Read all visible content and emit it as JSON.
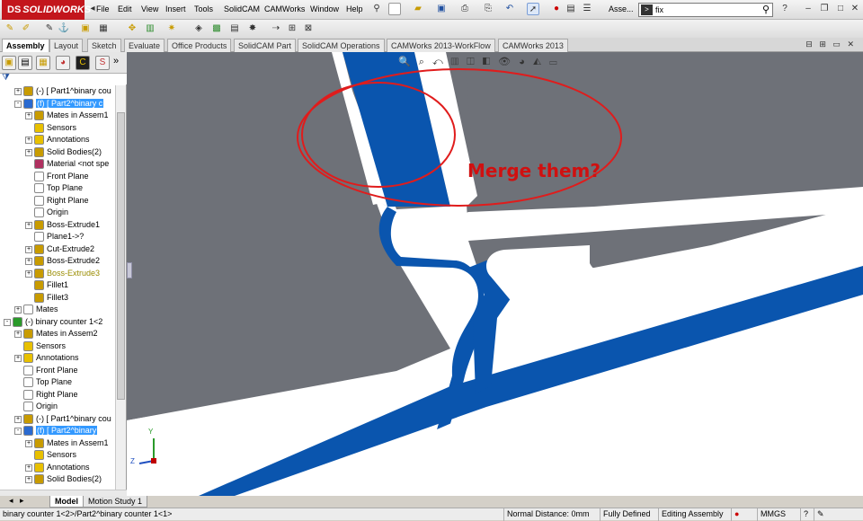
{
  "app": {
    "logo": "SOLIDWORKS",
    "brand_color": "#c3161c"
  },
  "menu": [
    "File",
    "Edit",
    "View",
    "Insert",
    "Tools",
    "SolidCAM",
    "CAMWorks",
    "Window",
    "Help"
  ],
  "title_doc": "Asse...",
  "search": {
    "value": "fix"
  },
  "tabs": [
    {
      "label": "Assembly"
    },
    {
      "label": "Layout"
    },
    {
      "label": "Sketch"
    },
    {
      "label": "Evaluate"
    },
    {
      "label": "Office Products"
    },
    {
      "label": "SolidCAM Part"
    },
    {
      "label": "SolidCAM Operations"
    },
    {
      "label": "CAMWorks 2013-WorkFlow"
    },
    {
      "label": "CAMWorks 2013"
    }
  ],
  "tree": [
    {
      "label": "(-) [ Part1^binary cou"
    },
    {
      "label": "(f) [ Part2^binary c"
    },
    {
      "label": "Mates in Assem1"
    },
    {
      "label": "Sensors"
    },
    {
      "label": "Annotations"
    },
    {
      "label": "Solid Bodies(2)"
    },
    {
      "label": "Material <not spe"
    },
    {
      "label": "Front Plane"
    },
    {
      "label": "Top Plane"
    },
    {
      "label": "Right Plane"
    },
    {
      "label": "Origin"
    },
    {
      "label": "Boss-Extrude1"
    },
    {
      "label": "Plane1->?"
    },
    {
      "label": "Cut-Extrude2"
    },
    {
      "label": "Boss-Extrude2"
    },
    {
      "label": "Boss-Extrude3"
    },
    {
      "label": "Fillet1"
    },
    {
      "label": "Fillet3"
    },
    {
      "label": "Mates"
    },
    {
      "label": "(-) binary counter 1<2"
    },
    {
      "label": "Mates in Assem2"
    },
    {
      "label": "Sensors"
    },
    {
      "label": "Annotations"
    },
    {
      "label": "Front Plane"
    },
    {
      "label": "Top Plane"
    },
    {
      "label": "Right Plane"
    },
    {
      "label": "Origin"
    },
    {
      "label": "(-) [ Part1^binary cou"
    },
    {
      "label": "(f) [ Part2^binary"
    },
    {
      "label": "Mates in Assem1"
    },
    {
      "label": "Sensors"
    },
    {
      "label": "Annotations"
    },
    {
      "label": "Solid Bodies(2)"
    }
  ],
  "callout": {
    "text": "Merge them?",
    "color": "#d01010"
  },
  "model_tabs": [
    {
      "label": "Model"
    },
    {
      "label": "Motion Study 1"
    }
  ],
  "status": {
    "path": "binary counter 1<2>/Part2^binary counter 1<1>",
    "distance": "Normal Distance: 0mm",
    "state": "Fully Defined",
    "mode": "Editing Assembly",
    "units": "MMGS"
  },
  "triad": {
    "y": "Y",
    "z": "Z"
  }
}
